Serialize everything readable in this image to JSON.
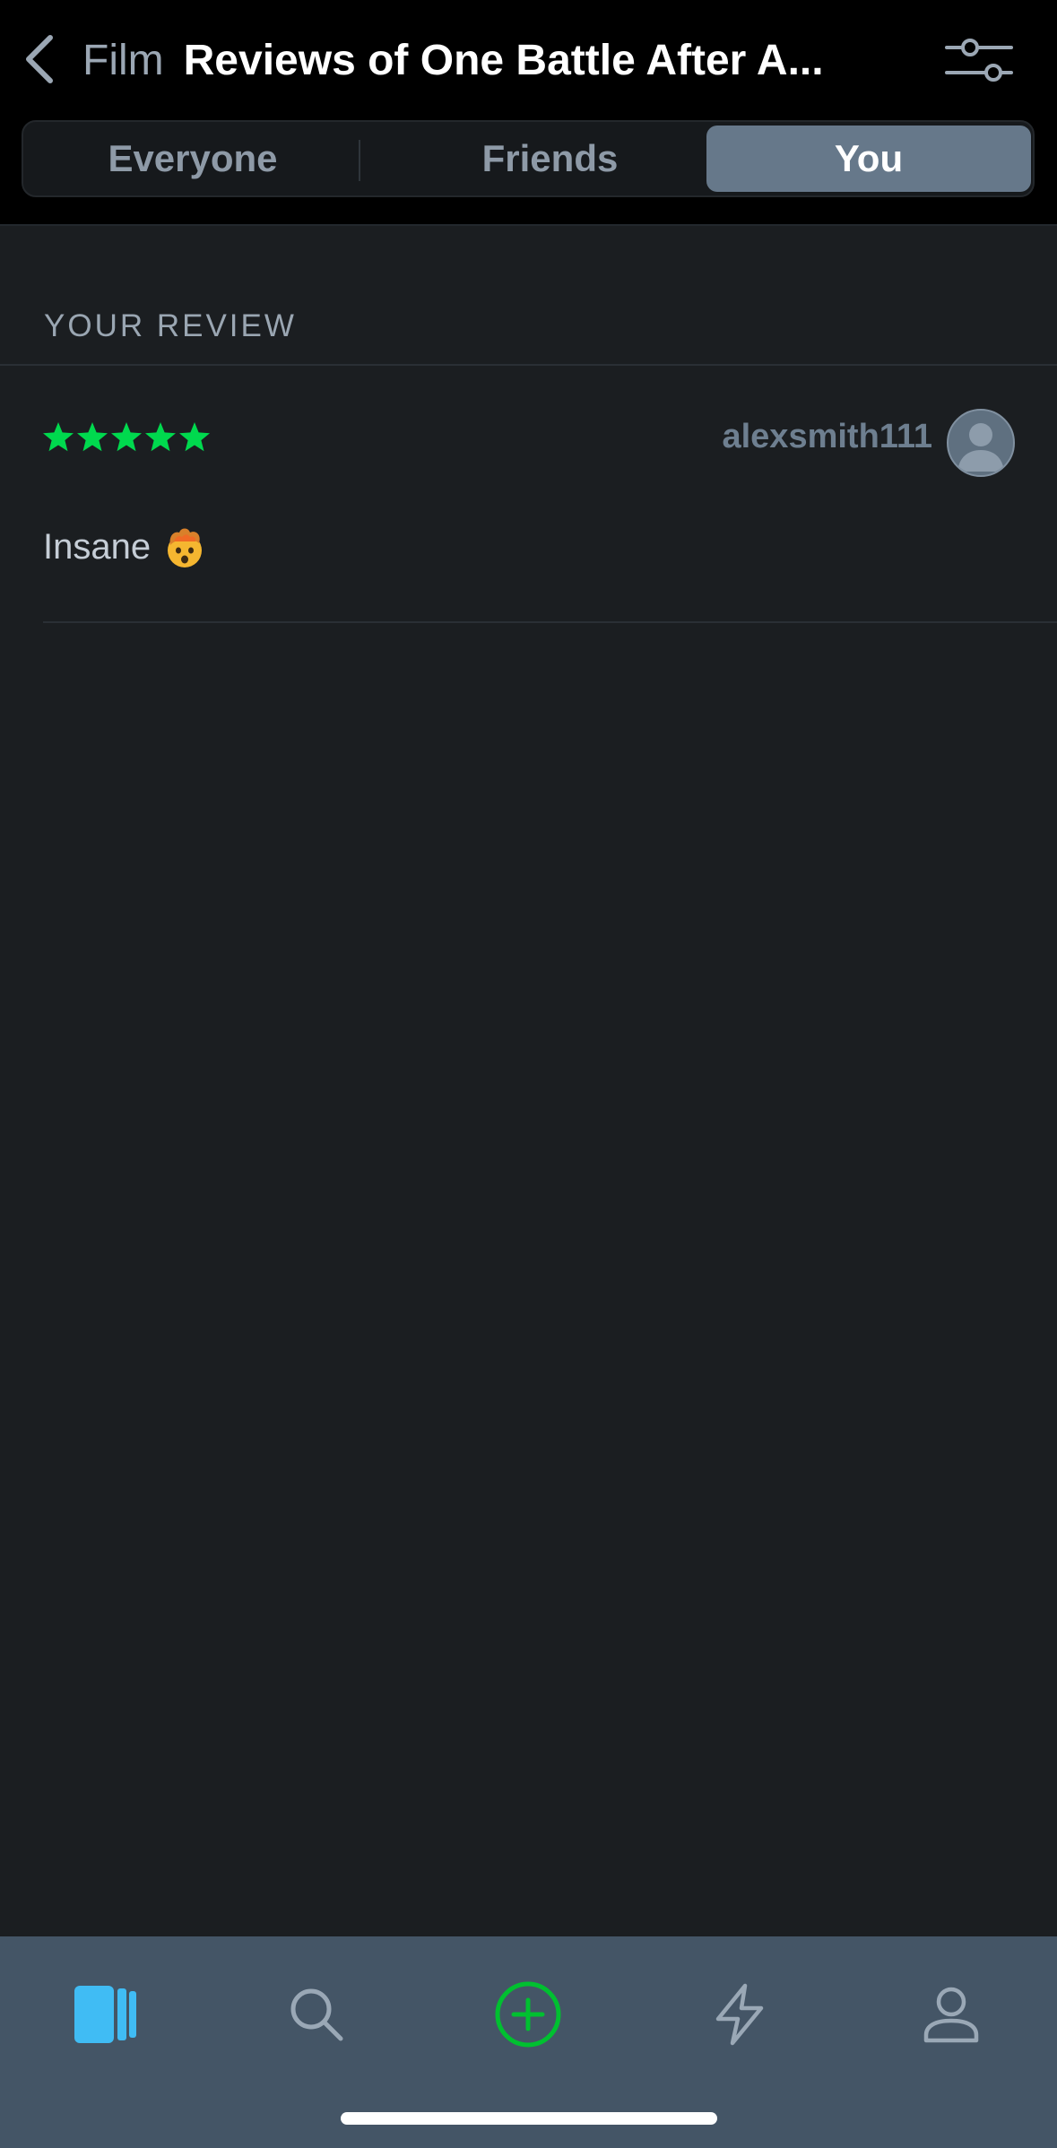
{
  "header": {
    "crumb": "Film",
    "title": "Reviews of One Battle After A...",
    "back_icon": "chevron-left-icon",
    "filter_icon": "sliders-icon"
  },
  "segments": {
    "everyone": "Everyone",
    "friends": "Friends",
    "you": "You",
    "selected": "You"
  },
  "review_section": {
    "label": "YOUR REVIEW",
    "rating_stars": 5,
    "rating_max": 5,
    "username": "alexsmith111",
    "text": "Insane",
    "emoji": "exploding-head-emoji"
  },
  "tabbar": {
    "items": [
      "films-icon",
      "search-icon",
      "add-icon",
      "activity-icon",
      "profile-icon"
    ],
    "selected": "films-icon"
  },
  "colors": {
    "background": "#1b1e21",
    "header": "#000000",
    "segment_selected": "#66788a",
    "star_green": "#00d94e",
    "tabbar": "#445566",
    "films_accent": "#40bcf4",
    "add_accent": "#00c030"
  }
}
